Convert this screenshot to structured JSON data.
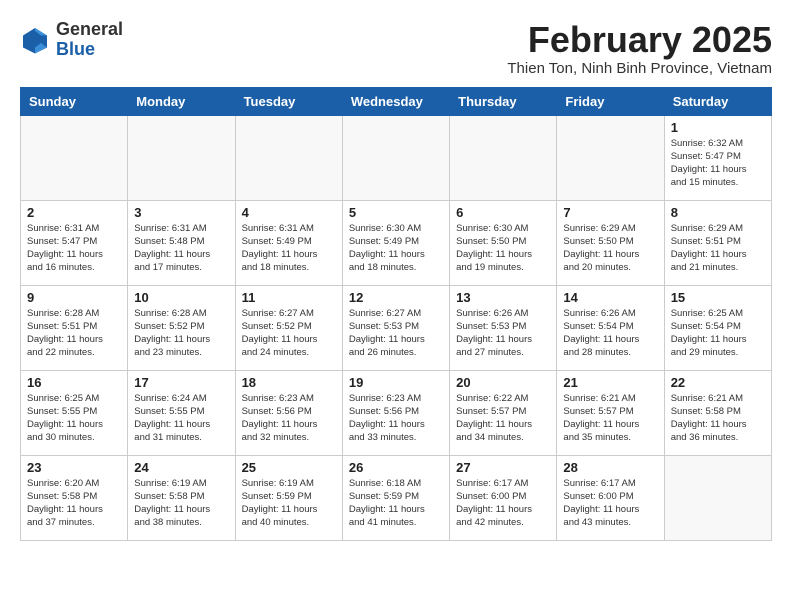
{
  "header": {
    "logo_line1": "General",
    "logo_line2": "Blue",
    "month_year": "February 2025",
    "location": "Thien Ton, Ninh Binh Province, Vietnam"
  },
  "weekdays": [
    "Sunday",
    "Monday",
    "Tuesday",
    "Wednesday",
    "Thursday",
    "Friday",
    "Saturday"
  ],
  "weeks": [
    [
      {
        "day": "",
        "info": ""
      },
      {
        "day": "",
        "info": ""
      },
      {
        "day": "",
        "info": ""
      },
      {
        "day": "",
        "info": ""
      },
      {
        "day": "",
        "info": ""
      },
      {
        "day": "",
        "info": ""
      },
      {
        "day": "1",
        "info": "Sunrise: 6:32 AM\nSunset: 5:47 PM\nDaylight: 11 hours\nand 15 minutes."
      }
    ],
    [
      {
        "day": "2",
        "info": "Sunrise: 6:31 AM\nSunset: 5:47 PM\nDaylight: 11 hours\nand 16 minutes."
      },
      {
        "day": "3",
        "info": "Sunrise: 6:31 AM\nSunset: 5:48 PM\nDaylight: 11 hours\nand 17 minutes."
      },
      {
        "day": "4",
        "info": "Sunrise: 6:31 AM\nSunset: 5:49 PM\nDaylight: 11 hours\nand 18 minutes."
      },
      {
        "day": "5",
        "info": "Sunrise: 6:30 AM\nSunset: 5:49 PM\nDaylight: 11 hours\nand 18 minutes."
      },
      {
        "day": "6",
        "info": "Sunrise: 6:30 AM\nSunset: 5:50 PM\nDaylight: 11 hours\nand 19 minutes."
      },
      {
        "day": "7",
        "info": "Sunrise: 6:29 AM\nSunset: 5:50 PM\nDaylight: 11 hours\nand 20 minutes."
      },
      {
        "day": "8",
        "info": "Sunrise: 6:29 AM\nSunset: 5:51 PM\nDaylight: 11 hours\nand 21 minutes."
      }
    ],
    [
      {
        "day": "9",
        "info": "Sunrise: 6:28 AM\nSunset: 5:51 PM\nDaylight: 11 hours\nand 22 minutes."
      },
      {
        "day": "10",
        "info": "Sunrise: 6:28 AM\nSunset: 5:52 PM\nDaylight: 11 hours\nand 23 minutes."
      },
      {
        "day": "11",
        "info": "Sunrise: 6:27 AM\nSunset: 5:52 PM\nDaylight: 11 hours\nand 24 minutes."
      },
      {
        "day": "12",
        "info": "Sunrise: 6:27 AM\nSunset: 5:53 PM\nDaylight: 11 hours\nand 26 minutes."
      },
      {
        "day": "13",
        "info": "Sunrise: 6:26 AM\nSunset: 5:53 PM\nDaylight: 11 hours\nand 27 minutes."
      },
      {
        "day": "14",
        "info": "Sunrise: 6:26 AM\nSunset: 5:54 PM\nDaylight: 11 hours\nand 28 minutes."
      },
      {
        "day": "15",
        "info": "Sunrise: 6:25 AM\nSunset: 5:54 PM\nDaylight: 11 hours\nand 29 minutes."
      }
    ],
    [
      {
        "day": "16",
        "info": "Sunrise: 6:25 AM\nSunset: 5:55 PM\nDaylight: 11 hours\nand 30 minutes."
      },
      {
        "day": "17",
        "info": "Sunrise: 6:24 AM\nSunset: 5:55 PM\nDaylight: 11 hours\nand 31 minutes."
      },
      {
        "day": "18",
        "info": "Sunrise: 6:23 AM\nSunset: 5:56 PM\nDaylight: 11 hours\nand 32 minutes."
      },
      {
        "day": "19",
        "info": "Sunrise: 6:23 AM\nSunset: 5:56 PM\nDaylight: 11 hours\nand 33 minutes."
      },
      {
        "day": "20",
        "info": "Sunrise: 6:22 AM\nSunset: 5:57 PM\nDaylight: 11 hours\nand 34 minutes."
      },
      {
        "day": "21",
        "info": "Sunrise: 6:21 AM\nSunset: 5:57 PM\nDaylight: 11 hours\nand 35 minutes."
      },
      {
        "day": "22",
        "info": "Sunrise: 6:21 AM\nSunset: 5:58 PM\nDaylight: 11 hours\nand 36 minutes."
      }
    ],
    [
      {
        "day": "23",
        "info": "Sunrise: 6:20 AM\nSunset: 5:58 PM\nDaylight: 11 hours\nand 37 minutes."
      },
      {
        "day": "24",
        "info": "Sunrise: 6:19 AM\nSunset: 5:58 PM\nDaylight: 11 hours\nand 38 minutes."
      },
      {
        "day": "25",
        "info": "Sunrise: 6:19 AM\nSunset: 5:59 PM\nDaylight: 11 hours\nand 40 minutes."
      },
      {
        "day": "26",
        "info": "Sunrise: 6:18 AM\nSunset: 5:59 PM\nDaylight: 11 hours\nand 41 minutes."
      },
      {
        "day": "27",
        "info": "Sunrise: 6:17 AM\nSunset: 6:00 PM\nDaylight: 11 hours\nand 42 minutes."
      },
      {
        "day": "28",
        "info": "Sunrise: 6:17 AM\nSunset: 6:00 PM\nDaylight: 11 hours\nand 43 minutes."
      },
      {
        "day": "",
        "info": ""
      }
    ]
  ]
}
